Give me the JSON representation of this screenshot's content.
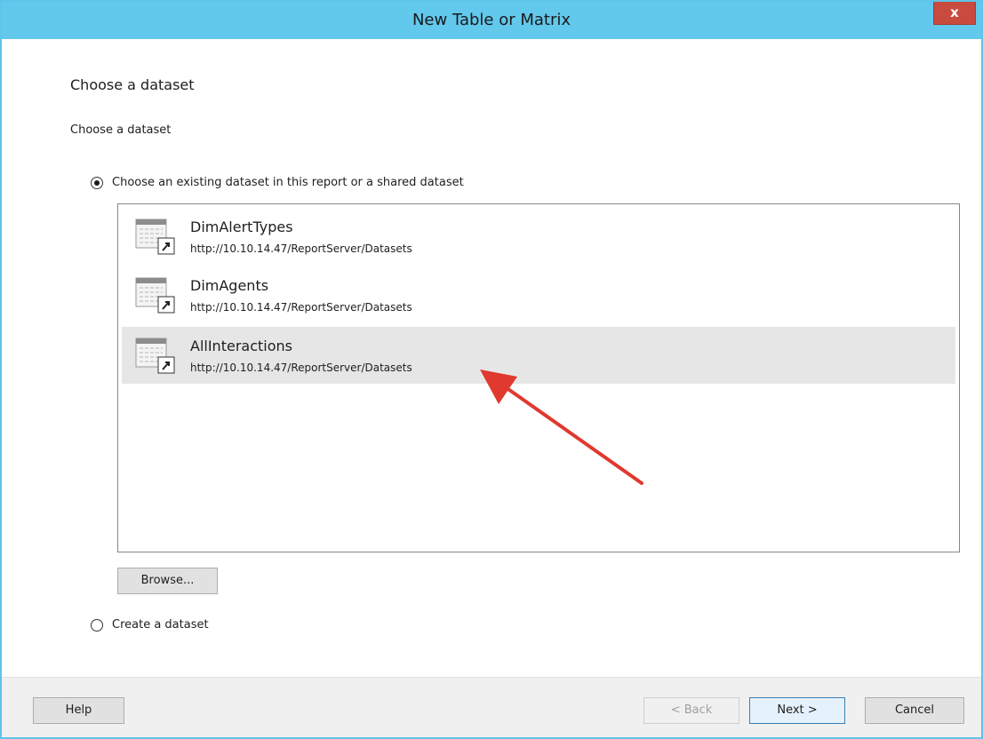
{
  "window": {
    "title": "New Table or Matrix",
    "close_label": "x"
  },
  "page": {
    "heading": "Choose a dataset",
    "section_label": "Choose a dataset"
  },
  "options": {
    "existing": {
      "label": "Choose an existing dataset in this report or a shared dataset",
      "checked": true
    },
    "create": {
      "label": "Create a dataset",
      "checked": false
    }
  },
  "datasets": [
    {
      "name": "DimAlertTypes",
      "url": "http://10.10.14.47/ReportServer/Datasets",
      "icon": "shared-dataset-icon",
      "selected": false
    },
    {
      "name": "DimAgents",
      "url": "http://10.10.14.47/ReportServer/Datasets",
      "icon": "shared-dataset-icon",
      "selected": false
    },
    {
      "name": "AllInteractions",
      "url": "http://10.10.14.47/ReportServer/Datasets",
      "icon": "shared-dataset-icon",
      "selected": true
    }
  ],
  "buttons": {
    "browse": "Browse...",
    "help": "Help",
    "back": "< Back",
    "next": "Next >",
    "cancel": "Cancel"
  },
  "colors": {
    "titlebar": "#62c8ec",
    "close": "#c94a3f",
    "selection": "#e6e6e6",
    "annotation_arrow": "#e0392f"
  }
}
